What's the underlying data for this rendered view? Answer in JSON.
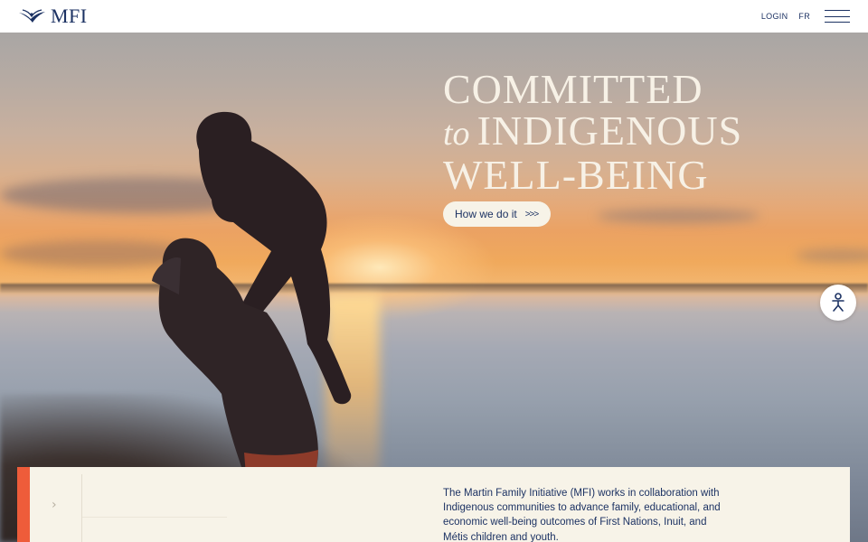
{
  "header": {
    "logo_text": "MFI",
    "login_label": "LOGIN",
    "language_label": "FR",
    "menu_icon": "hamburger-menu-icon"
  },
  "hero": {
    "title_line1": "COMMITTED",
    "title_to": "to",
    "title_line2": "INDIGENOUS",
    "title_line3": "WELL-BEING",
    "cta_label": "How we do it",
    "cta_icon": "triple-chevron-right-icon"
  },
  "accessibility": {
    "icon": "accessibility-person-icon"
  },
  "intro": {
    "description": "The Martin Family Initiative (MFI) works in collaboration with Indigenous communities to advance family, educational, and economic well-being outcomes of First Nations, Inuit, and Métis children and youth.",
    "nav_icon": "chevron-right-icon"
  },
  "colors": {
    "navy": "#1c3263",
    "cream": "#f7f3e8",
    "accent": "#ee5c3a"
  }
}
